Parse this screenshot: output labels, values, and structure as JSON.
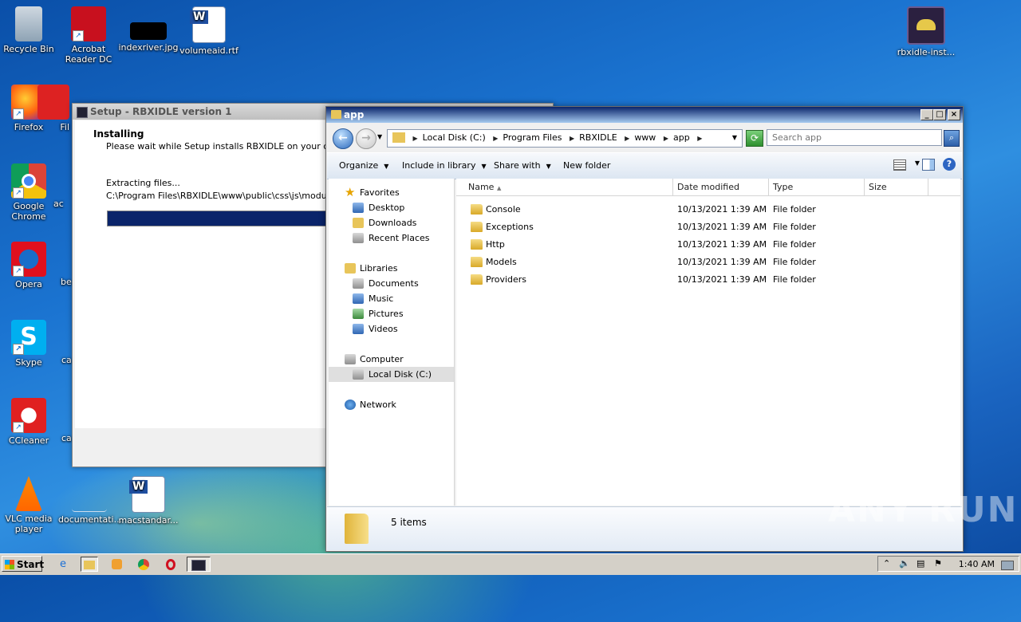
{
  "desktop": {
    "icons": [
      {
        "label": "Recycle Bin"
      },
      {
        "label": "Acrobat Reader DC"
      },
      {
        "label": "indexriver.jpg"
      },
      {
        "label": "volumeaid.rtf"
      },
      {
        "label": "Firefox"
      },
      {
        "label": "Fil"
      },
      {
        "label": "Google Chrome"
      },
      {
        "label": "ac"
      },
      {
        "label": "Opera"
      },
      {
        "label": "be"
      },
      {
        "label": "Skype"
      },
      {
        "label": "ca"
      },
      {
        "label": "CCleaner"
      },
      {
        "label": "ca"
      },
      {
        "label": "VLC media player"
      },
      {
        "label": "documentati..."
      },
      {
        "label": "macstandar..."
      },
      {
        "label": "rbxidle-inst..."
      }
    ]
  },
  "setup": {
    "title": "Setup - RBXIDLE version 1",
    "heading": "Installing",
    "subtitle": "Please wait while Setup installs RBXIDLE on your compute",
    "status": "Extracting files...",
    "path": "C:\\Program Files\\RBXIDLE\\www\\public\\css\\js\\modules\\stic",
    "progress": 0.5
  },
  "explorer": {
    "title": "app",
    "breadcrumb": [
      "Local Disk (C:)",
      "Program Files",
      "RBXIDLE",
      "www",
      "app"
    ],
    "search_placeholder": "Search app",
    "commands": {
      "organize": "Organize",
      "include": "Include in library",
      "share": "Share with",
      "new_folder": "New folder"
    },
    "nav": {
      "favorites": "Favorites",
      "desktop": "Desktop",
      "downloads": "Downloads",
      "recent": "Recent Places",
      "libraries": "Libraries",
      "documents": "Documents",
      "music": "Music",
      "pictures": "Pictures",
      "videos": "Videos",
      "computer": "Computer",
      "local_disk": "Local Disk (C:)",
      "network": "Network"
    },
    "columns": {
      "name": "Name",
      "date": "Date modified",
      "type": "Type",
      "size": "Size"
    },
    "files": [
      {
        "name": "Console",
        "date": "10/13/2021 1:39 AM",
        "type": "File folder"
      },
      {
        "name": "Exceptions",
        "date": "10/13/2021 1:39 AM",
        "type": "File folder"
      },
      {
        "name": "Http",
        "date": "10/13/2021 1:39 AM",
        "type": "File folder"
      },
      {
        "name": "Models",
        "date": "10/13/2021 1:39 AM",
        "type": "File folder"
      },
      {
        "name": "Providers",
        "date": "10/13/2021 1:39 AM",
        "type": "File folder"
      }
    ],
    "item_count": "5 items"
  },
  "taskbar": {
    "start_label": "Start",
    "clock": "1:40 AM"
  },
  "watermark": "ANY RUN"
}
